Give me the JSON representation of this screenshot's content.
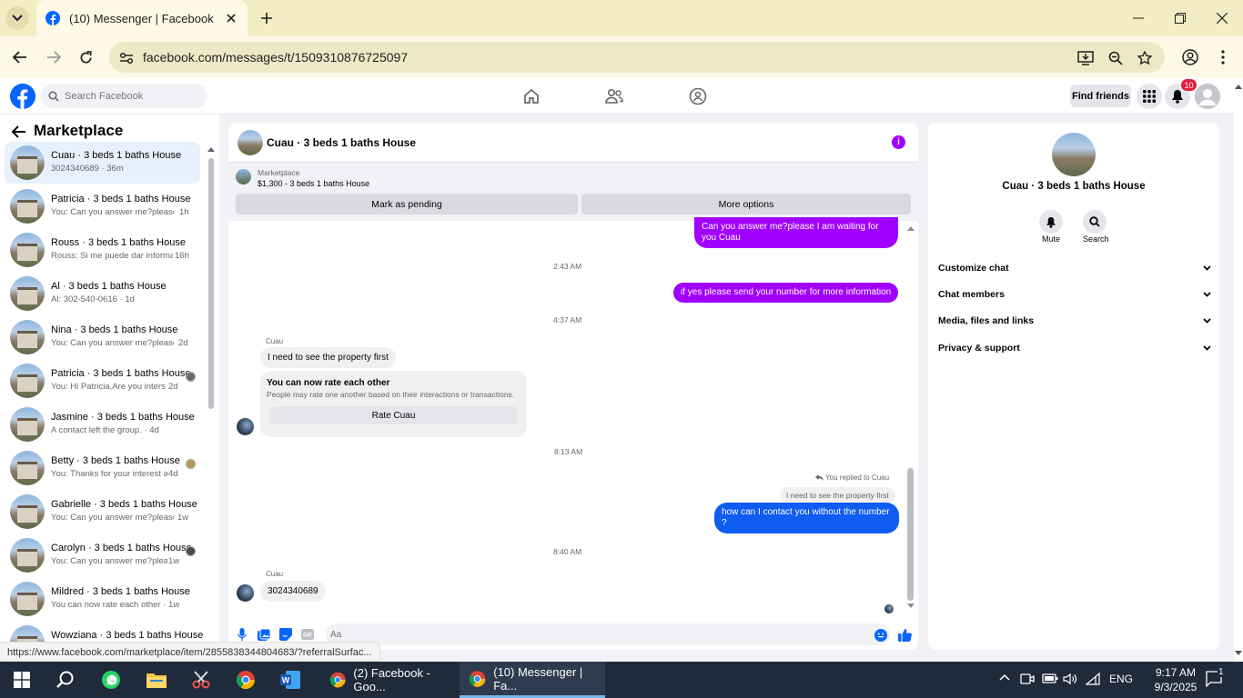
{
  "browser": {
    "tab_title": "(10) Messenger | Facebook",
    "url": "facebook.com/messages/t/1509310876725097",
    "status_link": "https://www.facebook.com/marketplace/item/2855838344804683/?referralSurfac..."
  },
  "fb": {
    "search_placeholder": "Search Facebook",
    "find_friends": "Find friends",
    "notif_count": "10"
  },
  "sidebar": {
    "title": "Marketplace",
    "conversations": [
      {
        "name": "Cuau · 3 beds 1 baths House",
        "preview": "3024340689 · 36m",
        "time": ""
      },
      {
        "name": "Patricia · 3 beds 1 baths House",
        "preview": "You: Can you answer me?please I ...",
        "time": "1h"
      },
      {
        "name": "Rouss · 3 beds 1 baths House",
        "preview": "Rouss: Si me puede dar informac...",
        "time": "16h"
      },
      {
        "name": "Al · 3 beds 1 baths House",
        "preview": "Al: 302-540-0616 · 1d",
        "time": ""
      },
      {
        "name": "Nina · 3 beds 1 baths House",
        "preview": "You: Can you answer me?please I ...",
        "time": "2d"
      },
      {
        "name": "Patricia · 3 beds 1 baths House",
        "preview": "You: Hi Patricia,Are you interste...",
        "time": "2d"
      },
      {
        "name": "Jasmine · 3 beds 1 baths House",
        "preview": "A contact left the group. · 4d",
        "time": ""
      },
      {
        "name": "Betty · 3 beds 1 baths House",
        "preview": "You: Thanks for your interest an...",
        "time": "4d"
      },
      {
        "name": "Gabrielle · 3 beds 1 baths House",
        "preview": "You: Can you answer me?please I ...",
        "time": "1w"
      },
      {
        "name": "Carolyn · 3 beds 1 baths House",
        "preview": "You: Can you answer me?pleas...",
        "time": "1w"
      },
      {
        "name": "Mildred · 3 beds 1 baths House",
        "preview": "You can now rate each other · 1w",
        "time": ""
      },
      {
        "name": "Wowziana · 3 beds 1 baths House",
        "preview": "",
        "time": ""
      }
    ]
  },
  "chat": {
    "title": "Cuau · 3 beds 1 baths House",
    "listing_label": "Marketplace",
    "listing_price": "$1,300 - 3 beds 1 baths House",
    "mark_pending": "Mark as pending",
    "more_options": "More options",
    "msg1": "Can you answer me?please I am waiting for you Cuau",
    "ts1": "2:43 AM",
    "msg2": "if yes please send your number for more information",
    "ts2": "4:37 AM",
    "sender": "Cuau",
    "msg3": "I need to see the property first",
    "rate_title": "You can now rate each other",
    "rate_desc": "People may rate one another based on their interactions or transactions.",
    "rate_button": "Rate Cuau",
    "ts3": "8:13 AM",
    "replied_label": "You replied to Cuau",
    "reply_quote": "I need to see the property first",
    "msg4": "how can I contact you without the number ?",
    "ts4": "8:40 AM",
    "msg5": "3024340689",
    "input_placeholder": "Aa"
  },
  "details": {
    "name": "Cuau · 3 beds 1 baths House",
    "mute": "Mute",
    "search": "Search",
    "sections": [
      "Customize chat",
      "Chat members",
      "Media, files and links",
      "Privacy & support"
    ]
  },
  "taskbar": {
    "task1": "(2) Facebook - Goo...",
    "task2": "(10) Messenger | Fa...",
    "lang": "ENG",
    "time": "9:17 AM",
    "date": "9/3/2025",
    "notif": "1"
  }
}
